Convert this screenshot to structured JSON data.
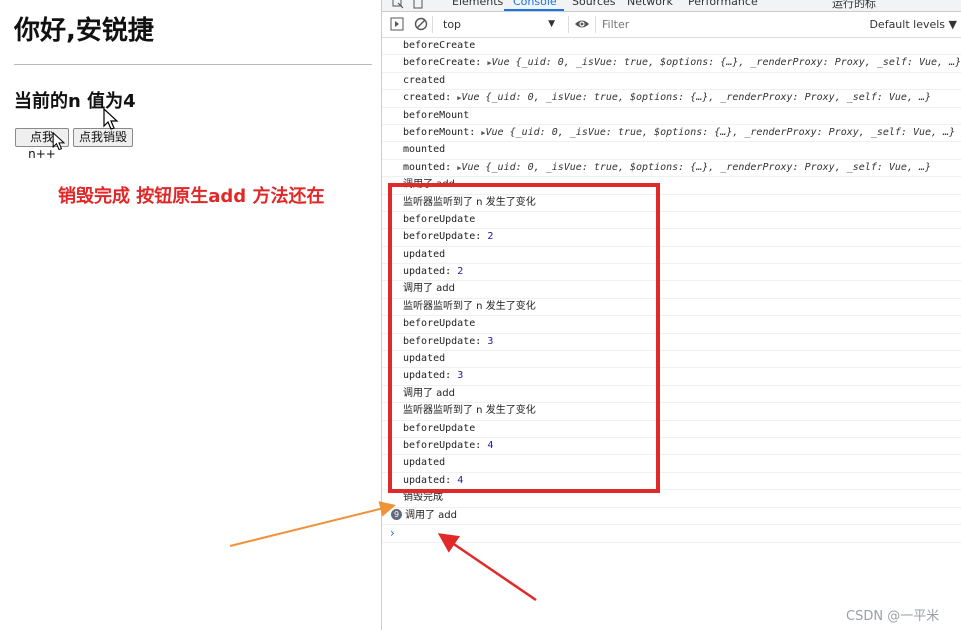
{
  "page": {
    "title": "你好,安锐捷",
    "counter_text": "当前的n 值为4",
    "buttons": {
      "add": "点我n++",
      "destroy": "点我销毁"
    },
    "annotation": "销毁完成 按钮原生add 方法还在"
  },
  "devtools": {
    "tabs": [
      "Elements",
      "Console",
      "Sources",
      "Network",
      "Performance",
      "运行的标"
    ],
    "active_tab": "Console",
    "toolbar": {
      "context": "top",
      "filter_placeholder": "Filter",
      "levels": "Default levels ▼"
    },
    "console_rows": [
      {
        "text": "beforeCreate"
      },
      {
        "label": "beforeCreate:",
        "obj": "Vue {_uid: 0, _isVue: true, $options: {…}, _renderProxy: Proxy, _self: Vue, …}"
      },
      {
        "text": "created"
      },
      {
        "label": "created:",
        "obj": "Vue {_uid: 0, _isVue: true, $options: {…}, _renderProxy: Proxy, _self: Vue, …}"
      },
      {
        "text": "beforeMount"
      },
      {
        "label": "beforeMount:",
        "obj": "Vue {_uid: 0, _isVue: true, $options: {…}, _renderProxy: Proxy, _self: Vue, …}"
      },
      {
        "text": "mounted"
      },
      {
        "label": "mounted:",
        "obj": "Vue {_uid: 0, _isVue: true, $options: {…}, _renderProxy: Proxy, _self: Vue, …}"
      },
      {
        "text": "调用了 add",
        "cjk": true
      },
      {
        "text": "监听器监听到了 n 发生了变化",
        "cjk": true
      },
      {
        "text": "beforeUpdate"
      },
      {
        "label": "beforeUpdate:",
        "num": "2"
      },
      {
        "text": "updated"
      },
      {
        "label": "updated:",
        "num": "2"
      },
      {
        "text": "调用了 add",
        "cjk": true
      },
      {
        "text": "监听器监听到了 n 发生了变化",
        "cjk": true
      },
      {
        "text": "beforeUpdate"
      },
      {
        "label": "beforeUpdate:",
        "num": "3"
      },
      {
        "text": "updated"
      },
      {
        "label": "updated:",
        "num": "3"
      },
      {
        "text": "调用了 add",
        "cjk": true
      },
      {
        "text": "监听器监听到了 n 发生了变化",
        "cjk": true
      },
      {
        "text": "beforeUpdate"
      },
      {
        "label": "beforeUpdate:",
        "num": "4"
      },
      {
        "text": "updated"
      },
      {
        "label": "updated:",
        "num": "4"
      },
      {
        "text": "销毁完成",
        "cjk": true
      },
      {
        "text": "调用了 add",
        "cjk": true,
        "badge": "9"
      }
    ],
    "prompt": "›"
  },
  "watermark": "CSDN @一平米",
  "colors": {
    "annotation_red": "#e02828",
    "arrow_orange": "#f0923a",
    "accent_blue": "#1a73e8"
  },
  "icons": [
    "inspect-icon",
    "device-icon",
    "sidebar-toggle-icon",
    "clear-console-icon",
    "eye-icon",
    "mouse-cursor-icon"
  ]
}
